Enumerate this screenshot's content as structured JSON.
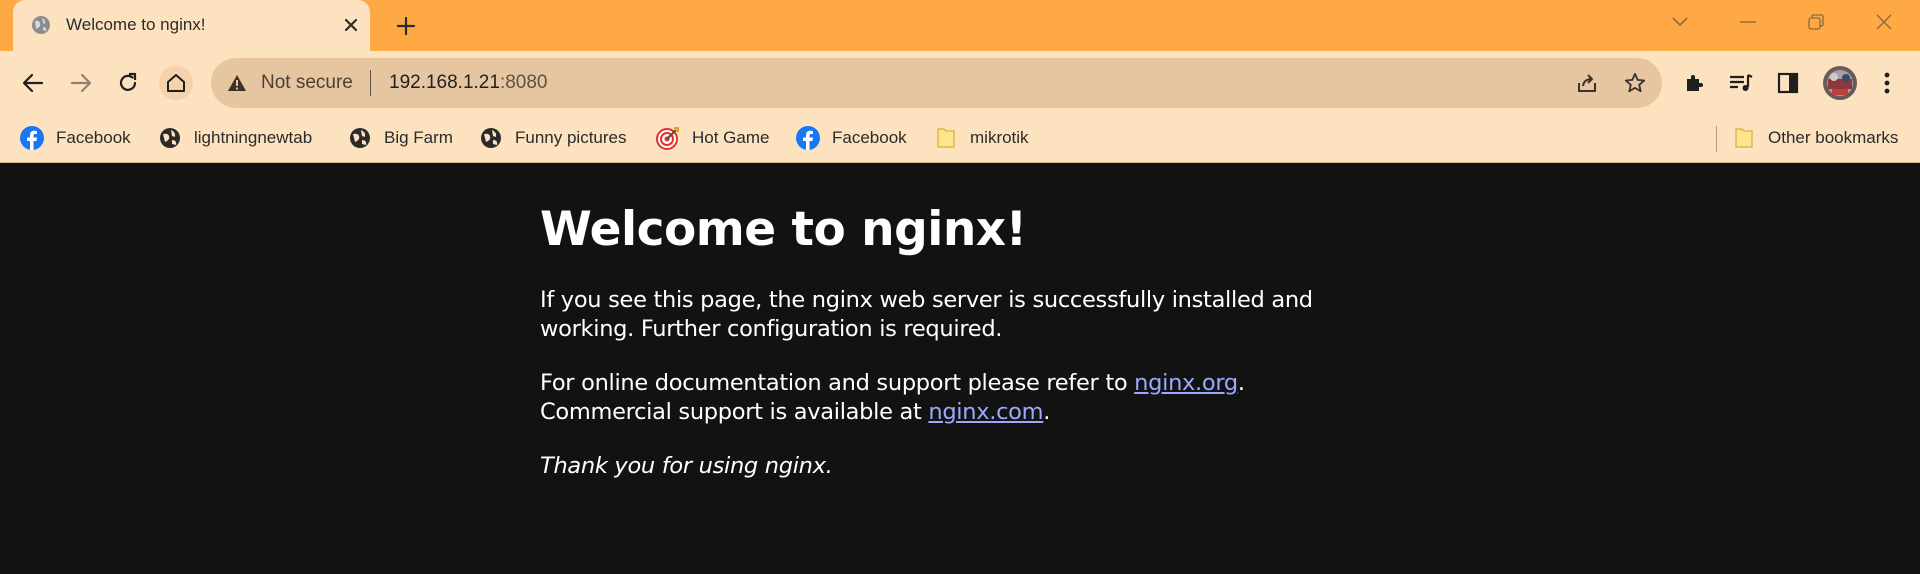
{
  "browser": {
    "tab": {
      "title": "Welcome to nginx!",
      "favicon": "globe-icon"
    },
    "new_tab_label": "+",
    "omnibox": {
      "security_text": "Not secure",
      "host": "192.168.1.21",
      "port": ":8080"
    },
    "bookmarks": [
      {
        "label": "Facebook",
        "icon": "facebook-icon"
      },
      {
        "label": "lightningnewtab",
        "icon": "globe-icon"
      },
      {
        "label": "Big Farm",
        "icon": "globe-icon"
      },
      {
        "label": "Funny pictures",
        "icon": "globe-icon"
      },
      {
        "label": "Hot Game",
        "icon": "target-icon"
      },
      {
        "label": "Facebook",
        "icon": "facebook-icon"
      },
      {
        "label": "mikrotik",
        "icon": "folder-icon"
      }
    ],
    "other_bookmarks": "Other bookmarks",
    "colors": {
      "tabstrip": "#fea943",
      "toolbar": "#fde2c0",
      "omnibox": "#e6c6a1",
      "page_bg": "#121212",
      "link": "#9aa8ff"
    }
  },
  "page": {
    "heading": "Welcome to nginx!",
    "p1_line1": "If you see this page, the nginx web server is successfully installed and",
    "p1_line2": "working. Further configuration is required.",
    "p2_text1": "For online documentation and support please refer to ",
    "p2_link1": "nginx.org",
    "p2_text2": ".",
    "p2_text3": "Commercial support is available at ",
    "p2_link2": "nginx.com",
    "p2_text4": ".",
    "p3": "Thank you for using nginx."
  }
}
